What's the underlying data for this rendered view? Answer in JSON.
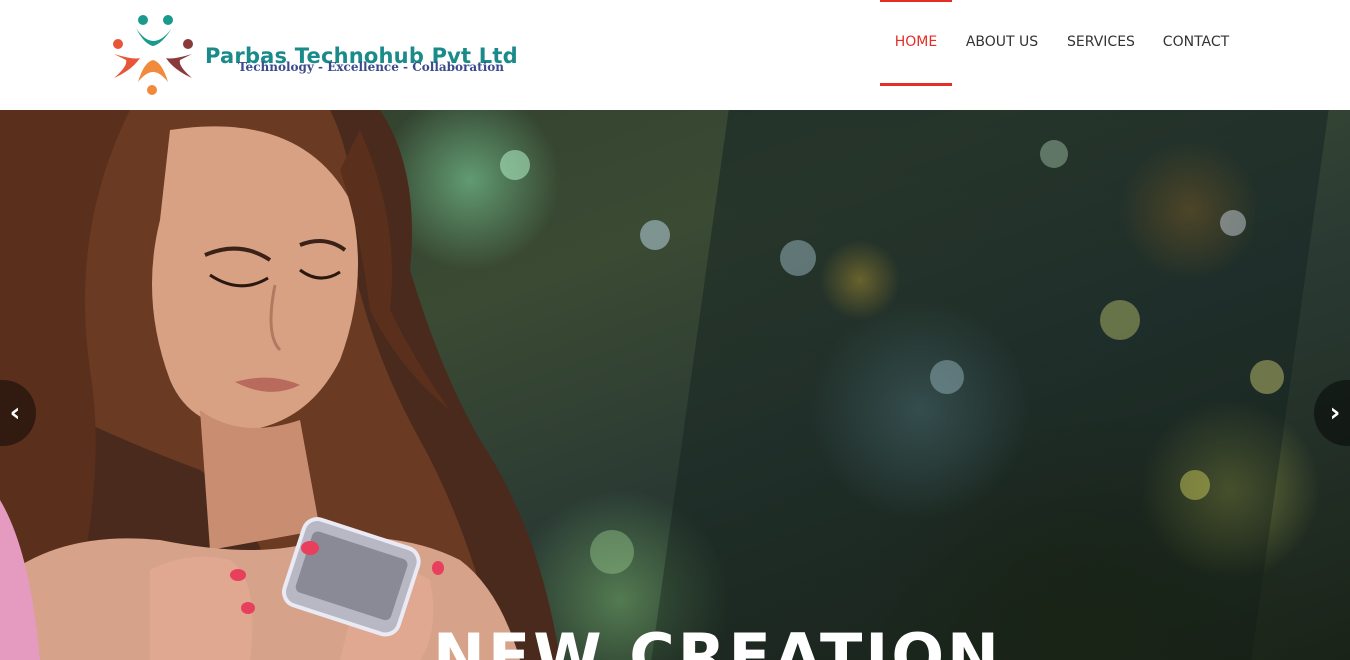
{
  "header": {
    "brand_name": "Parbas Technohub Pvt Ltd",
    "tagline": "Technology - Excellence - Collaboration"
  },
  "nav": {
    "items": [
      {
        "label": "HOME",
        "active": true
      },
      {
        "label": "ABOUT US",
        "active": false
      },
      {
        "label": "SERVICES",
        "active": false
      },
      {
        "label": "CONTACT",
        "active": false
      }
    ]
  },
  "hero": {
    "title": "NEW CREATION",
    "prev_icon": "chevron-left-icon",
    "next_icon": "chevron-right-icon"
  },
  "colors": {
    "accent": "#e52d27",
    "brand_teal": "#1a8a8a",
    "brand_orange": "#f08a3c",
    "brand_red": "#e04a4a",
    "brand_maroon": "#8a3a3a",
    "nav_text": "#333333"
  }
}
